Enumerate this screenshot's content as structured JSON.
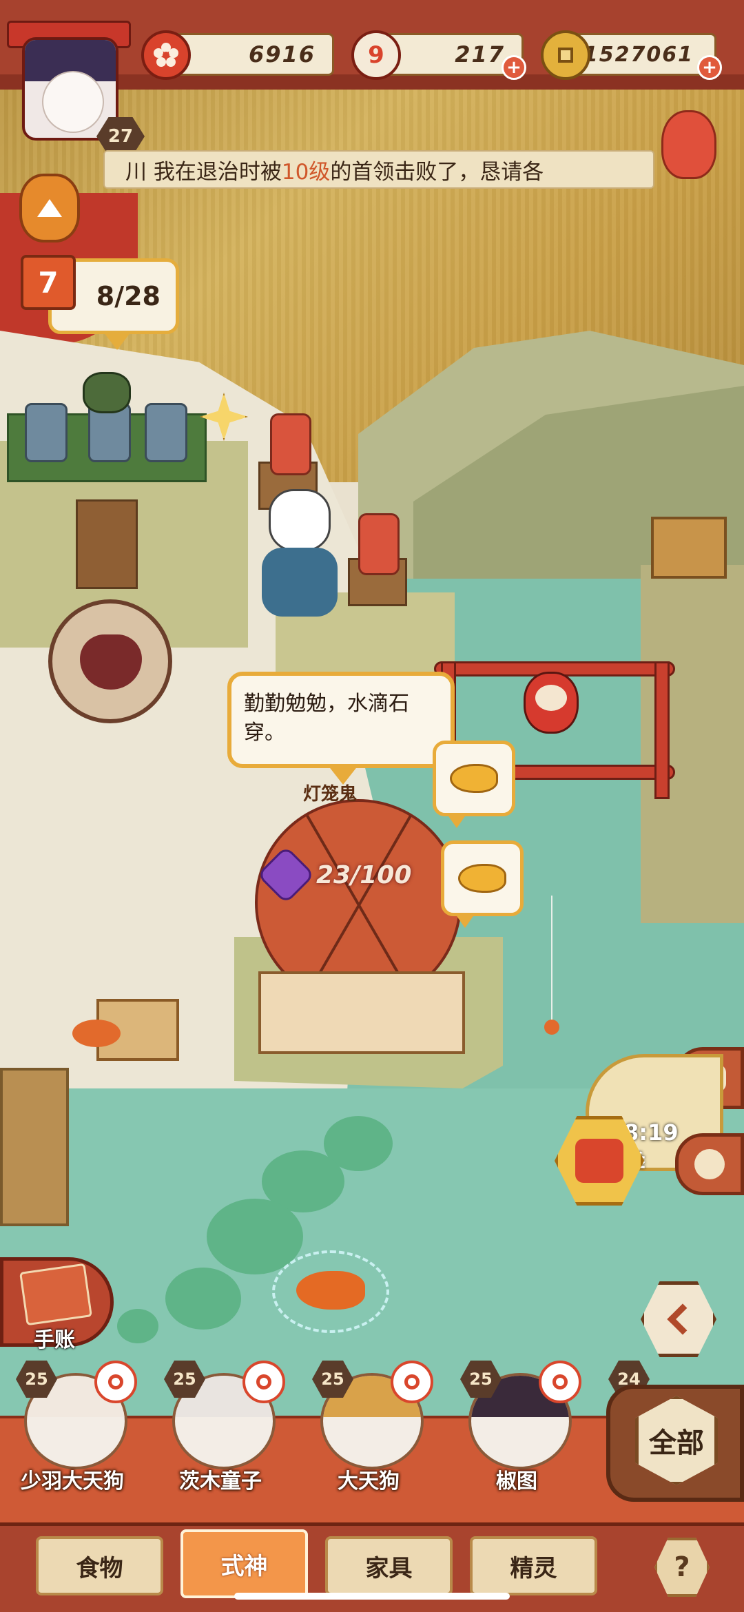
{
  "player": {
    "level": "27"
  },
  "resources": {
    "plum": {
      "value": "6916",
      "icon": "plum-blossom-icon",
      "color": "#d9432c"
    },
    "stamina": {
      "value": "217",
      "icon": "stamina-number-icon",
      "icon_text": "9",
      "color": "#d9432c"
    },
    "coins": {
      "value": "1527061",
      "icon": "gold-coin-icon",
      "color": "#d9a532"
    }
  },
  "news_ticker": {
    "prefix": "川 我在退治时被",
    "highlight": "10级",
    "suffix": "的首领击败了，恳请各"
  },
  "calendar": {
    "day": "7",
    "progress": "8/28"
  },
  "speech_bubble": {
    "text": "勤勤勉勉，水滴石穿。"
  },
  "stall": {
    "name": "灯笼鬼",
    "hearts": "23/100"
  },
  "event": {
    "timer": "8:19",
    "sub": "季"
  },
  "journal": {
    "label": "手账"
  },
  "characters": [
    {
      "level": "25",
      "name": "少羽大天狗",
      "hair": "#f1e8df"
    },
    {
      "level": "25",
      "name": "茨木童子",
      "hair": "#e9e4e0"
    },
    {
      "level": "25",
      "name": "大天狗",
      "hair": "#d9a24a"
    },
    {
      "level": "25",
      "name": "椒图",
      "hair": "#3a2a3a"
    },
    {
      "level": "24",
      "name": ""
    }
  ],
  "all_button": {
    "label": "全部"
  },
  "tabs": [
    {
      "label": "食物",
      "active": false
    },
    {
      "label": "式神",
      "active": true
    },
    {
      "label": "家具",
      "active": false
    },
    {
      "label": "精灵",
      "active": false
    }
  ],
  "help": {
    "label": "?"
  }
}
